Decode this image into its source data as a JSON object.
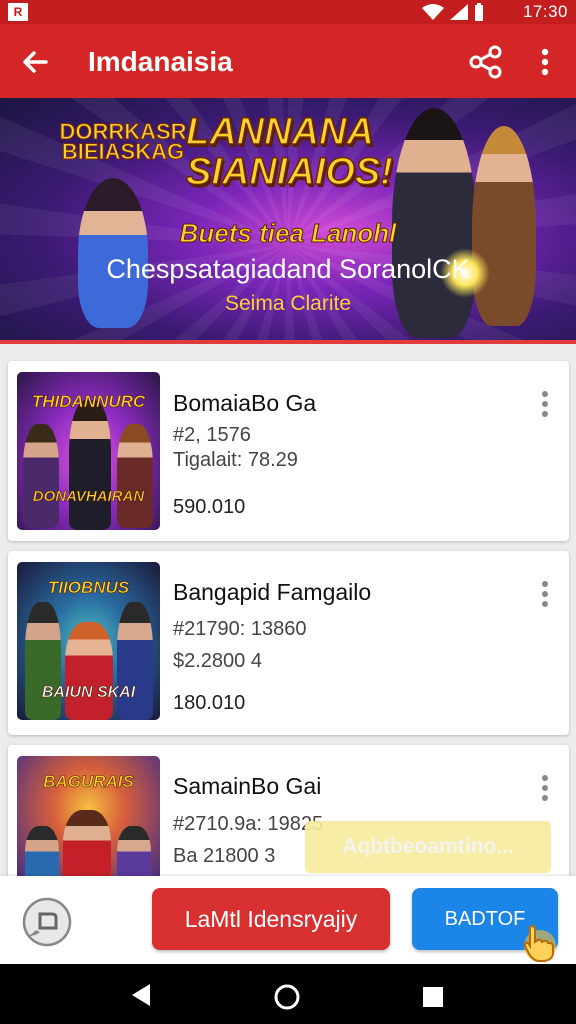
{
  "status_bar": {
    "app_icon_glyph": "R",
    "time": "17:30"
  },
  "app_bar": {
    "title": "Imdanaisia",
    "back_icon": "arrow-left-icon",
    "share_icon": "share-icon",
    "more_icon": "more-vertical-icon"
  },
  "banner": {
    "logo_small": "DORRKASR BIEIASKAG",
    "logo_big": "LANNANA SIANIAIOS!",
    "tagline": "Buets tiea Lanohl",
    "headline": "Chespsatagiadand SoranolCK",
    "subhead": "Seima Clarite"
  },
  "items": [
    {
      "name": "BomaiaBo Ga",
      "line1": "#2, 1576",
      "line2": "Tigalait:  78.29",
      "price": "590.010",
      "thumb_title": "THIDANNURC",
      "thumb_footer": "DONAVHAIRAN"
    },
    {
      "name": "Bangapid Famgailo",
      "line1": "#21790: 13860",
      "line2": "$2.2800 4",
      "price": "180.010",
      "thumb_title": "TIIOBNUS",
      "thumb_footer": "BAIUN SKAI"
    },
    {
      "name": "SamainBo Gai",
      "line1": "#2710.9a: 19825",
      "line2": "Ba 21800 3",
      "price": "",
      "thumb_title": "BAGURAIS",
      "thumb_footer": ""
    }
  ],
  "toast": {
    "text": "Aqbtbeoamtino..."
  },
  "actions": {
    "primary_label": "LaMtl Idensryajiy",
    "secondary_label": "BADTOF"
  },
  "colors": {
    "primary": "#d42626",
    "accent": "#1c86e8",
    "banner": "#5a1fa0"
  }
}
